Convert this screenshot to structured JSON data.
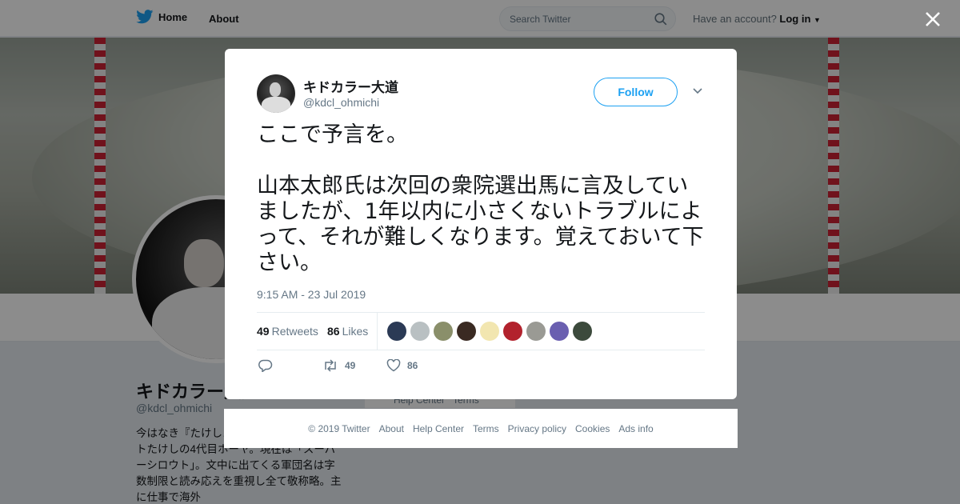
{
  "topbar": {
    "home_label": "Home",
    "about_label": "About",
    "search_placeholder": "Search Twitter",
    "account_prompt": "Have an account?",
    "login_label": "Log in"
  },
  "profile": {
    "name": "キドカラー大道",
    "handle": "@kdcl_ohmichi",
    "bio": "今はなき『たけし… 員。 現逸脱者。ヒートたけしの4代目ホーヤ。現在は「スーパーシロウト」。文中に出てくる軍団名は字数制限と読み応えを重視し全て敬称略。主に仕事で海外",
    "help_center_label": "Help Center",
    "terms_label": "Terms"
  },
  "tweet": {
    "author_name": "キドカラー大道",
    "author_handle": "@kdcl_ohmichi",
    "follow_label": "Follow",
    "text": "ここで予言を。\n\n山本太郎氏は次回の衆院選出馬に言及していましたが、1年以内に小さくないトラブルによって、それが難しくなります。覚えておいて下さい。",
    "timestamp": "9:15 AM - 23 Jul 2019",
    "retweets_count": "49",
    "retweets_label": "Retweets",
    "likes_count": "86",
    "likes_label": "Likes",
    "likers": [
      {
        "color": "#2b3a55"
      },
      {
        "color": "#b9c0c2"
      },
      {
        "color": "#8a8f6a"
      },
      {
        "color": "#3a2a22"
      },
      {
        "color": "#f2e6b0"
      },
      {
        "color": "#b2222d"
      },
      {
        "color": "#9a9a94"
      },
      {
        "color": "#6a5fb0"
      },
      {
        "color": "#3c4a3c"
      }
    ],
    "action_retweet_count": "49",
    "action_like_count": "86"
  },
  "footer": {
    "links": [
      "© 2019 Twitter",
      "About",
      "Help Center",
      "Terms",
      "Privacy policy",
      "Cookies",
      "Ads info"
    ]
  },
  "colors": {
    "accent": "#1da1f2",
    "text_secondary": "#657786"
  }
}
